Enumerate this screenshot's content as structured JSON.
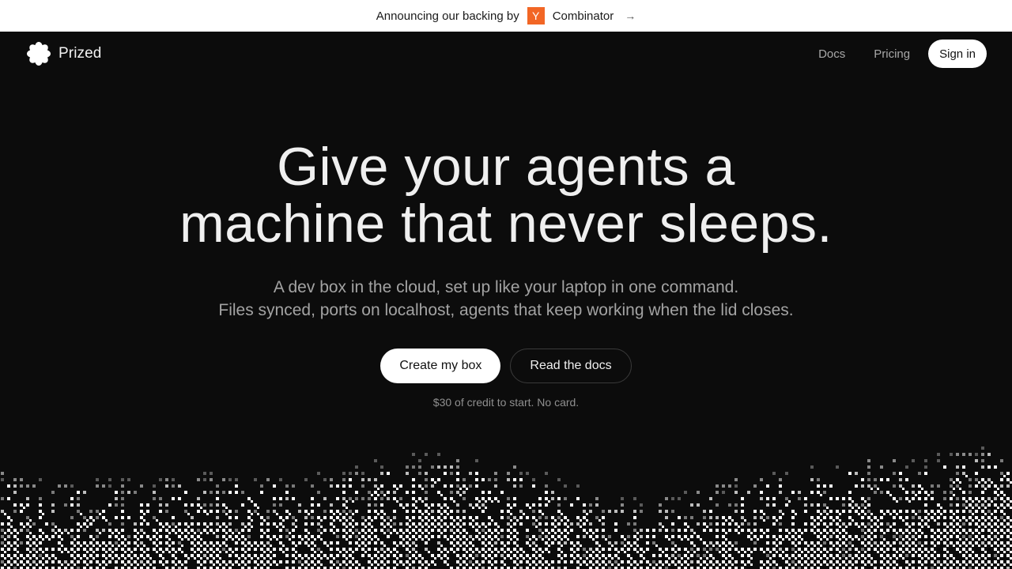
{
  "announcement": {
    "prefix": "Announcing our backing by",
    "yc_letter": "Y",
    "suffix": "Combinator",
    "arrow": "→",
    "yc_color": "#f26625"
  },
  "nav": {
    "brand": "Prized",
    "logo_icon": "asterisk-flower-icon",
    "links": [
      "Docs",
      "Pricing"
    ],
    "signin": "Sign in"
  },
  "hero": {
    "headline_line1": "Give your agents a",
    "headline_line2": "machine that never sleeps.",
    "sub_line1": "A dev box in the cloud, set up like your laptop in one command.",
    "sub_line2": "Files synced, ports on localhost, agents that keep working when the lid closes.",
    "primary_cta": "Create my box",
    "secondary_cta": "Read the docs",
    "note": "$30 of credit to start. No card."
  },
  "colors": {
    "background": "#0c0c0c",
    "text": "#ececec",
    "muted": "#a3a3a3"
  }
}
